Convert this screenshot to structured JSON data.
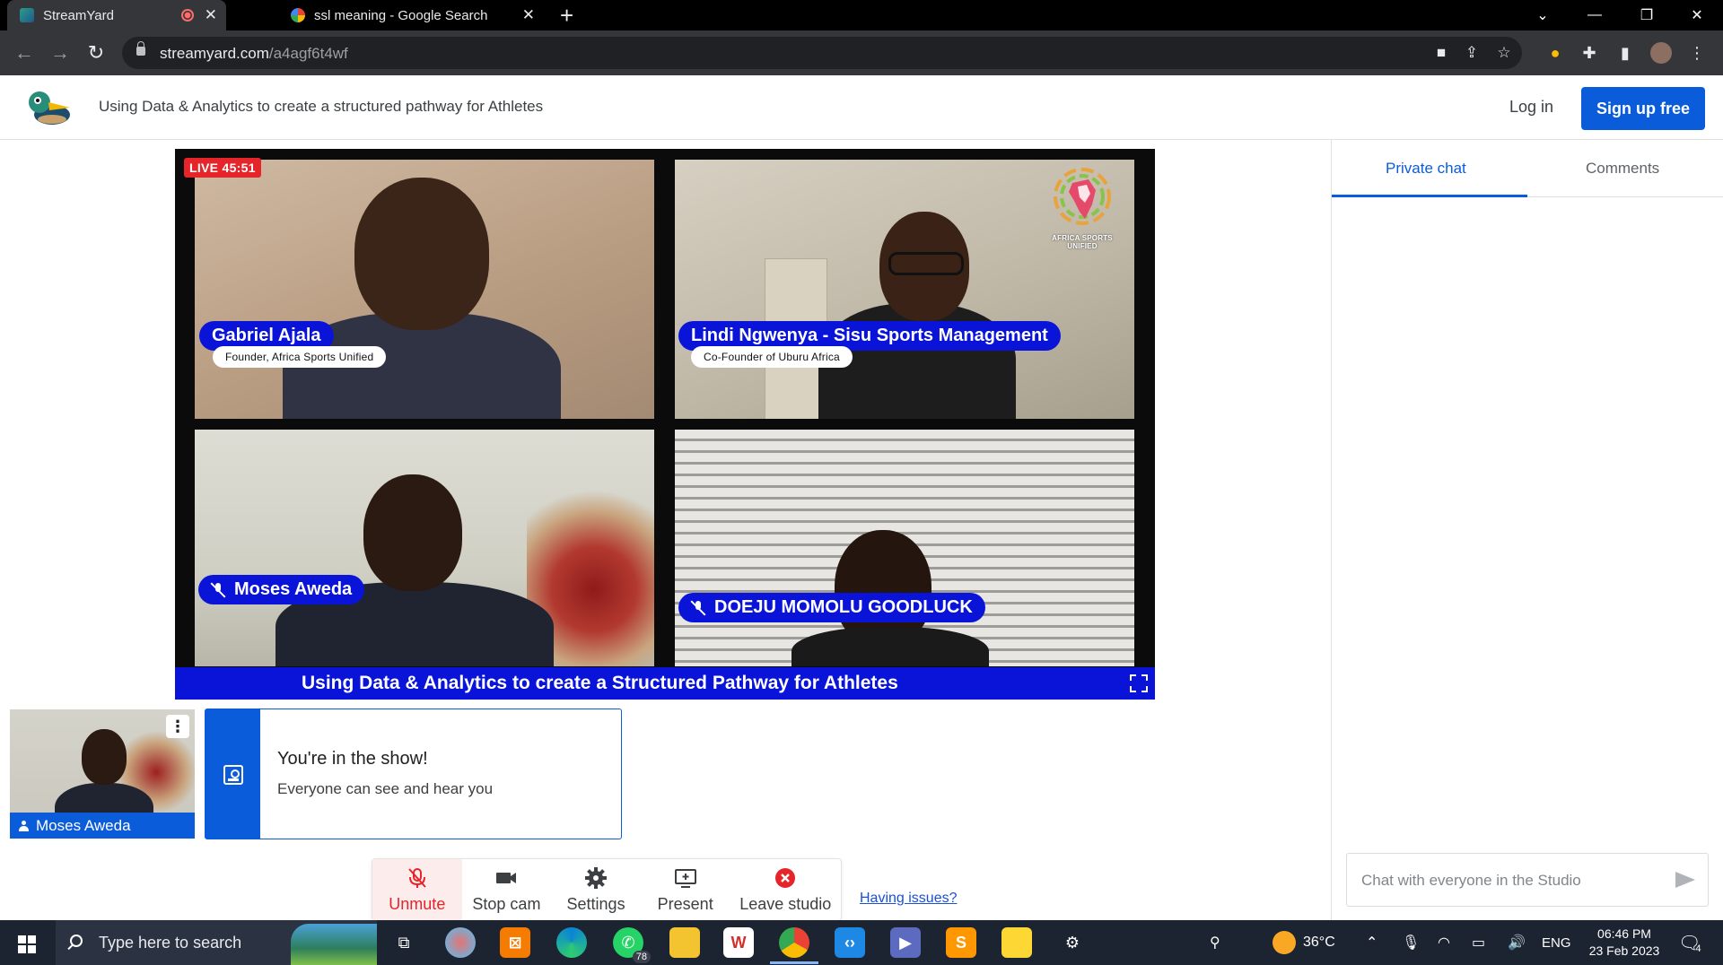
{
  "browser": {
    "tabs": [
      {
        "title": "StreamYard",
        "active": true,
        "recording": true
      },
      {
        "title": "ssl meaning - Google Search",
        "active": false
      }
    ],
    "url_host": "streamyard.com",
    "url_path": "/a4agf6t4wf",
    "window_controls": [
      "chevron-down-icon",
      "minimize-icon",
      "restore-icon",
      "close-icon"
    ]
  },
  "header": {
    "show_title": "Using Data & Analytics to create a structured pathway for Athletes",
    "login_label": "Log in",
    "signup_label": "Sign up free"
  },
  "stage": {
    "live_badge": "LIVE 45:51",
    "participants": [
      {
        "name": "Gabriel Ajala",
        "subtitle": "Founder, Africa Sports Unified",
        "muted": false
      },
      {
        "name": "Lindi Ngwenya - Sisu Sports Management",
        "subtitle": "Co-Founder of Uburu Africa",
        "muted": false
      },
      {
        "name": "Moses Aweda",
        "muted": true
      },
      {
        "name": "DOEJU MOMOLU GOODLUCK",
        "muted": true
      }
    ],
    "overlay_logo_text": "AFRICA SPORTS UNIFIED",
    "banner": "Using Data & Analytics to create a Structured Pathway for Athletes"
  },
  "self_preview": {
    "name": "Moses Aweda"
  },
  "notice": {
    "title": "You're in the show!",
    "body": "Everyone can see and hear you"
  },
  "controls": {
    "unmute": "Unmute",
    "stop_cam": "Stop cam",
    "settings": "Settings",
    "present": "Present",
    "leave": "Leave studio",
    "having_issues": "Having issues?"
  },
  "chat": {
    "tabs": [
      "Private chat",
      "Comments"
    ],
    "active_tab": "Private chat",
    "placeholder": "Chat with everyone in the Studio"
  },
  "taskbar": {
    "search_placeholder": "Type here to search",
    "whatsapp_badge": "78",
    "weather": "36°C",
    "language": "ENG",
    "time": "06:46 PM",
    "date": "23 Feb 2023",
    "notification_count": "4"
  },
  "colors": {
    "brand_blue": "#0a5cdb",
    "banner_blue": "#0a14d8",
    "live_red": "#e5252a"
  }
}
